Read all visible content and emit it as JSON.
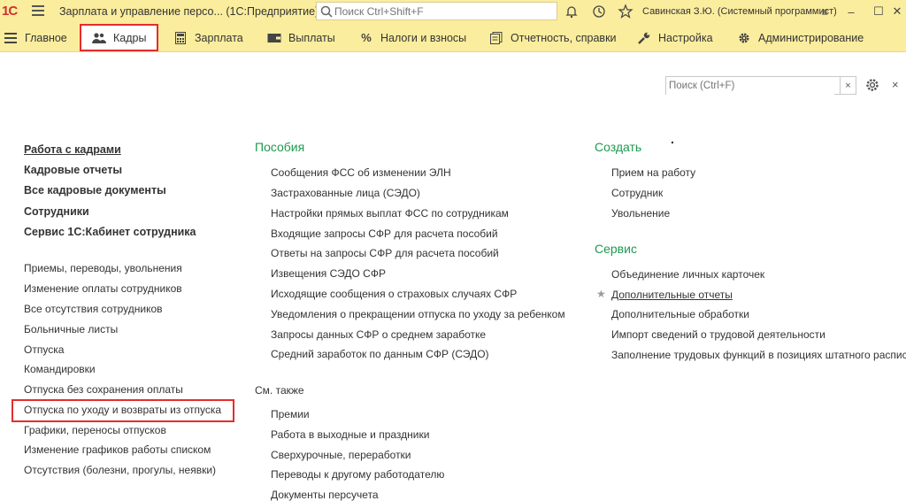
{
  "titlebar": {
    "logo": "1С",
    "app_title": "Зарплата и управление персо...  (1С:Предприятие)",
    "search_placeholder": "Поиск Ctrl+Shift+F",
    "user": "Савинская З.Ю. (Системный программист)",
    "icons": [
      "menu-icon",
      "bell-icon",
      "history-icon",
      "star-icon",
      "more-icon",
      "minimize-icon",
      "maximize-icon",
      "close-icon"
    ]
  },
  "menubar": {
    "items": [
      {
        "label": "Главное",
        "icon": "menu-icon"
      },
      {
        "label": "Кадры",
        "icon": "people-icon"
      },
      {
        "label": "Зарплата",
        "icon": "calculator-icon"
      },
      {
        "label": "Выплаты",
        "icon": "wallet-icon"
      },
      {
        "label": "Налоги и взносы",
        "icon": "percent-icon"
      },
      {
        "label": "Отчетность, справки",
        "icon": "reports-icon"
      },
      {
        "label": "Настройка",
        "icon": "wrench-icon"
      },
      {
        "label": "Администрирование",
        "icon": "gear-icon"
      }
    ],
    "active": "Кадры"
  },
  "page_search": {
    "placeholder": "Поиск (Ctrl+F)",
    "clear": "×",
    "close": "×"
  },
  "left": {
    "bold_items": [
      "Работа с кадрами",
      "Кадровые отчеты",
      "Все кадровые документы",
      "Сотрудники",
      "Сервис 1С:Кабинет сотрудника"
    ],
    "items": [
      "Приемы, переводы, увольнения",
      "Изменение оплаты сотрудников",
      "Все отсутствия сотрудников",
      "Больничные листы",
      "Отпуска",
      "Командировки",
      "Отпуска без сохранения оплаты",
      "Отпуска по уходу и возвраты из отпуска",
      "Графики, переносы отпусков",
      "Изменение графиков работы списком",
      "Отсутствия (болезни, прогулы, неявки)"
    ]
  },
  "middle": {
    "heading": "Пособия",
    "items": [
      "Сообщения ФСС об изменении ЭЛН",
      "Застрахованные лица (СЭДО)",
      "Настройки прямых выплат ФСС по сотрудникам",
      "Входящие запросы СФР для расчета пособий",
      "Ответы на запросы СФР для расчета пособий",
      "Извещения СЭДО СФР",
      "Исходящие сообщения о страховых случаях СФР",
      "Уведомления о прекращении отпуска по уходу за ребенком",
      "Запросы данных СФР о среднем заработке",
      "Средний заработок по данным СФР (СЭДО)"
    ],
    "see_also": "См. также",
    "see_also_items": [
      "Премии",
      "Работа в выходные и праздники",
      "Сверхурочные, переработки",
      "Переводы к другому работодателю",
      "Документы персучета"
    ]
  },
  "right": {
    "create_heading": "Создать",
    "create_items": [
      "Прием на работу",
      "Сотрудник",
      "Увольнение"
    ],
    "service_heading": "Сервис",
    "service_items": [
      "Объединение личных карточек",
      "Дополнительные отчеты",
      "Дополнительные обработки",
      "Импорт сведений о трудовой деятельности",
      "Заполнение трудовых функций в позициях штатного расписания"
    ]
  },
  "colors": {
    "bar": "#fbed9e",
    "heading": "#1e9a4f",
    "highlight": "#e52c2c"
  }
}
